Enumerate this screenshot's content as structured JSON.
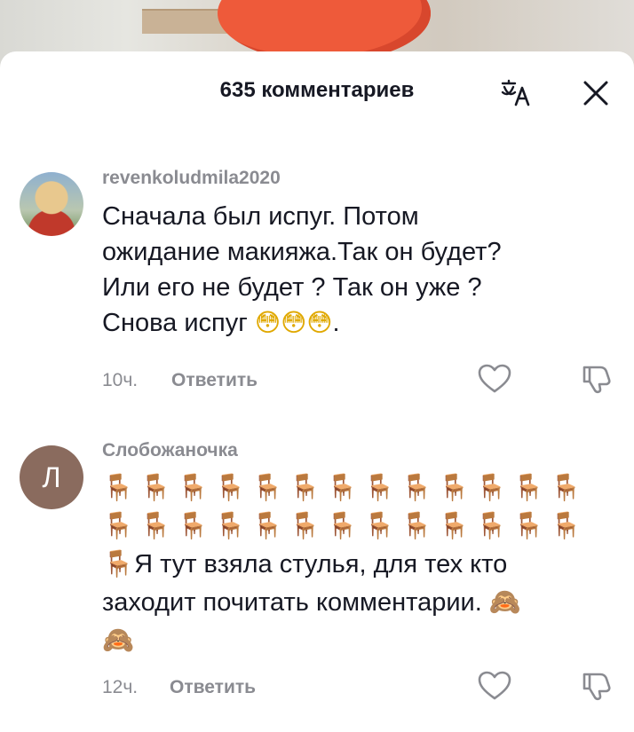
{
  "header": {
    "title": "635 комментариев",
    "translate_icon": "translate-icon",
    "close_icon": "close-icon"
  },
  "comments": [
    {
      "username": "revenkoludmila2020",
      "avatar_icon": "user-photo-avatar",
      "text_lines": [
        "Сначала был испуг. Потом",
        "ожидание макияжа.Так он будет?",
        "Или его не будет ? Так он уже ?",
        "Снова испуг"
      ],
      "trailing_emoji": "😳😳😳",
      "trailing_text": ".",
      "time": "10ч.",
      "reply_label": "Ответить"
    },
    {
      "username": "Слобожаночка",
      "avatar_letter": "Л",
      "chair_emoji": "🪑",
      "chair_rows": [
        13,
        13
      ],
      "text_line1": "Я тут взяла стулья, для тех кто",
      "text_line2": "заходит почитать комментарии.",
      "monkey_emoji": "🙈",
      "time": "12ч.",
      "reply_label": "Ответить"
    }
  ],
  "colors": {
    "text_primary": "#161823",
    "text_secondary": "#8a8b91",
    "avatar_letter_bg": "#8a6b5e"
  }
}
